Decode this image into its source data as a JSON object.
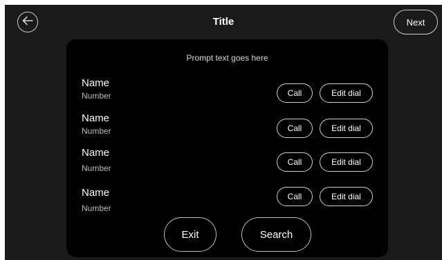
{
  "header": {
    "title": "Title",
    "back_icon": "arrow-left-icon",
    "next_label": "Next"
  },
  "panel": {
    "prompt": "Prompt text goes here",
    "contacts": [
      {
        "name": "Name",
        "number": "Number",
        "call_label": "Call",
        "edit_label": "Edit dial"
      },
      {
        "name": "Name",
        "number": "Number",
        "call_label": "Call",
        "edit_label": "Edit dial"
      },
      {
        "name": "Name",
        "number": "Number",
        "call_label": "Call",
        "edit_label": "Edit dial"
      },
      {
        "name": "Name",
        "number": "Number",
        "call_label": "Call",
        "edit_label": "Edit dial"
      }
    ],
    "exit_label": "Exit",
    "search_label": "Search"
  },
  "colors": {
    "background": "#1a1a1a",
    "panel": "#000000",
    "text": "#ffffff",
    "border": "#cfcfcf"
  }
}
